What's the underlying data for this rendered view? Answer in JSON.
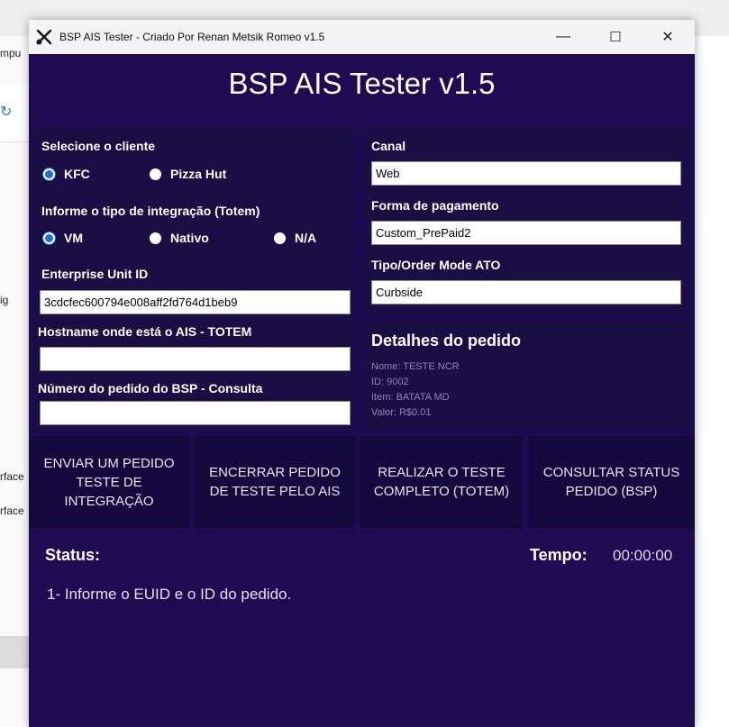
{
  "background": {
    "fragments": [
      "mpu",
      "ig",
      "rface",
      "rface"
    ]
  },
  "window": {
    "title": "BSP AIS Tester - Criado Por Renan Metsik Romeo v1.5",
    "controls": {
      "minimize": "—",
      "maximize": "☐",
      "close": "✕"
    },
    "header": "BSP AIS Tester v1.5"
  },
  "client": {
    "label": "Selecione o cliente",
    "options": [
      {
        "label": "KFC",
        "checked": true
      },
      {
        "label": "Pizza Hut",
        "checked": false
      }
    ]
  },
  "integration": {
    "label": "Informe o tipo de integração (Totem)",
    "options": [
      {
        "label": "VM",
        "checked": true
      },
      {
        "label": "Nativo",
        "checked": false
      },
      {
        "label": "N/A",
        "checked": false
      }
    ]
  },
  "enterprise_unit": {
    "label": "Enterprise Unit ID",
    "value": "3cdcfec600794e008aff2fd764d1beb9"
  },
  "hostname": {
    "label": "Hostname onde está o AIS - TOTEM",
    "value": ""
  },
  "order_number": {
    "label": "Número do pedido do BSP - Consulta",
    "value": ""
  },
  "canal": {
    "label": "Canal",
    "value": "Web"
  },
  "payment": {
    "label": "Forma de pagamento",
    "value": "Custom_PrePaid2"
  },
  "order_mode": {
    "label": "Tipo/Order Mode ATO",
    "value": "Curbside"
  },
  "details": {
    "title": "Detalhes do pedido",
    "lines": [
      "Nome: TESTE NCR",
      "ID: 9002",
      "Item: BATATA MD",
      "Valor: R$0.01"
    ]
  },
  "actions": [
    "ENVIAR UM PEDIDO TESTE DE INTEGRAÇÃO",
    "ENCERRAR PEDIDO DE TESTE PELO AIS",
    "REALIZAR O TESTE COMPLETO (TOTEM)",
    "CONSULTAR STATUS PEDIDO (BSP)"
  ],
  "status": {
    "label": "Status:",
    "message": "1- Informe o EUID e o ID do pedido.",
    "time_label": "Tempo:",
    "time_value": "00:00:00"
  },
  "colors": {
    "window_bg": "#1e0b52",
    "panel_bg": "#1a0f45",
    "button_bg": "#14093d",
    "radio_accent": "#1e6fd9"
  }
}
